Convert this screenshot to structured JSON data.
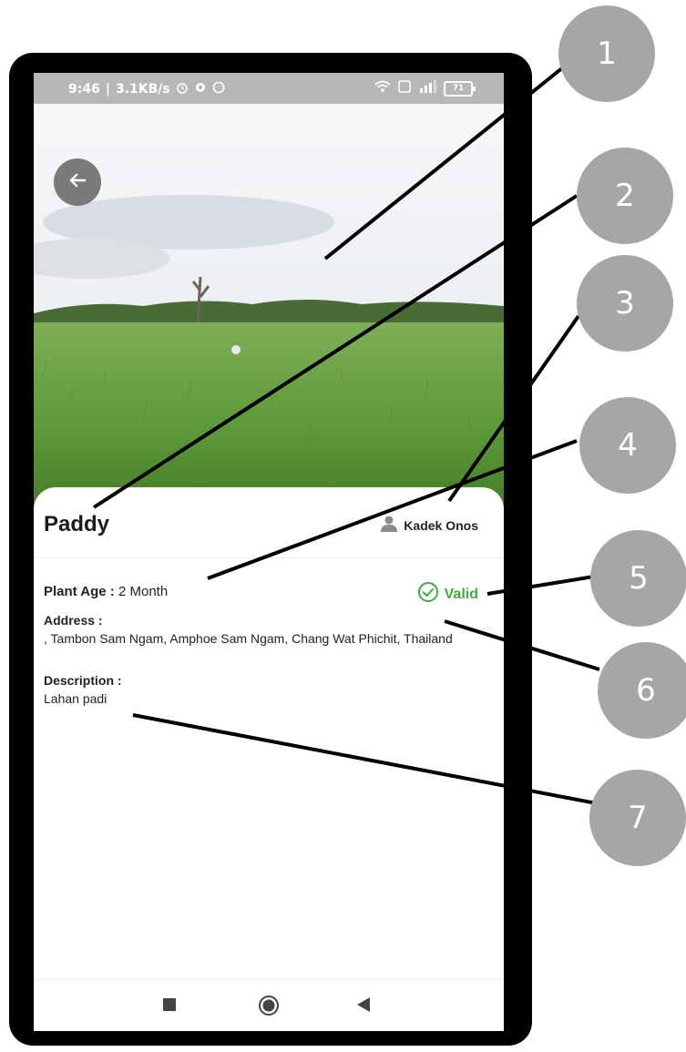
{
  "status_bar": {
    "time": "9:46",
    "network_speed": "3.1KB/s",
    "battery": "71"
  },
  "detail": {
    "title": "Paddy",
    "owner": "Kadek Onos",
    "plant_age_label": "Plant Age :",
    "plant_age_value": "2 Month",
    "status": "Valid",
    "address_label": "Address :",
    "address_value": ", Tambon Sam Ngam, Amphoe Sam Ngam, Chang Wat Phichit, Thailand",
    "description_label": "Description :",
    "description_value": "Lahan padi"
  },
  "callouts": [
    "1",
    "2",
    "3",
    "4",
    "5",
    "6",
    "7"
  ],
  "colors": {
    "accent_green": "#3faa46",
    "callout_gray": "#a6a6a6",
    "frame": "#000000"
  },
  "icons": [
    "back-arrow-icon",
    "person-icon",
    "check-circle-icon",
    "square-nav-icon",
    "circle-nav-icon",
    "triangle-back-nav-icon"
  ]
}
